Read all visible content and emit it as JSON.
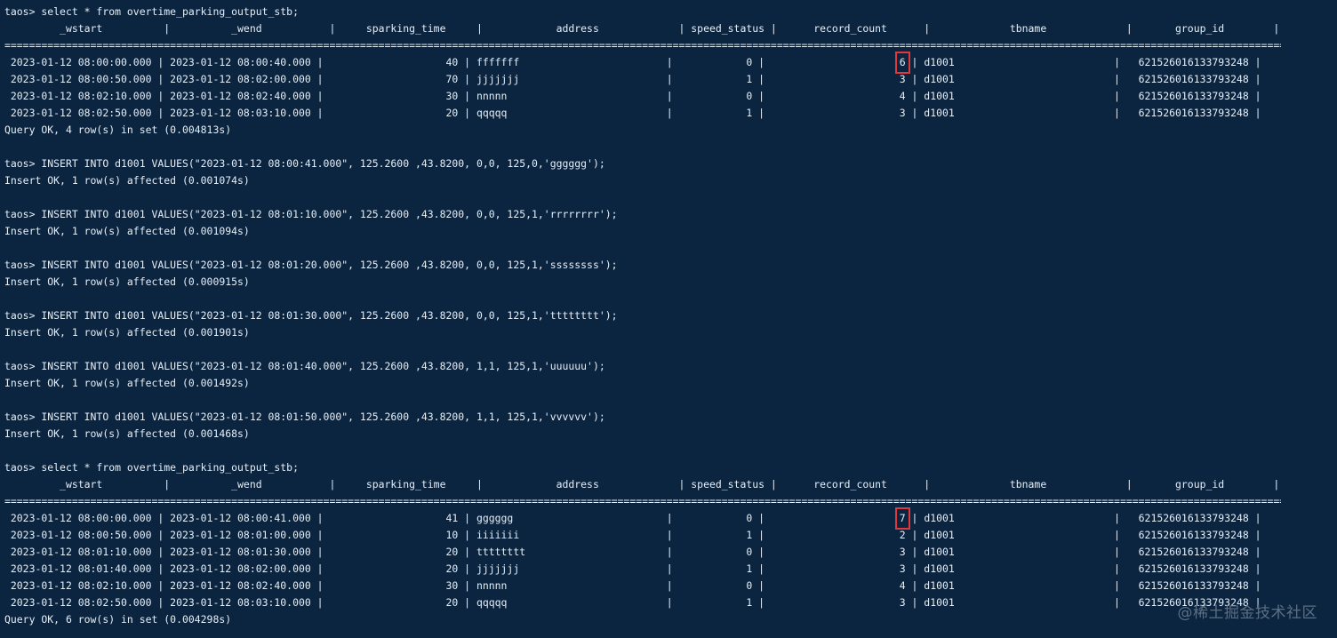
{
  "terminal": {
    "lines": [
      "taos> select * from overtime_parking_output_stb;",
      "         _wstart          |          _wend           |     sparking_time     |            address             | speed_status |      record_count      |             tbname             |       group_id        |",
      "=========================================================================================================================================================================================================================",
      " 2023-01-12 08:00:00.000 | 2023-01-12 08:00:40.000 |                    40 | fffffff                        |            0 |                      6 | d1001                          |   6215260161337932​48 |",
      " 2023-01-12 08:00:50.000 | 2023-01-12 08:02:00.000 |                    70 | jjjjjjj                        |            1 |                      3 | d1001                          |   621526016133793248 |",
      " 2023-01-12 08:02:10.000 | 2023-01-12 08:02:40.000 |                    30 | nnnnn                          |            0 |                      4 | d1001                          |   621526016133793248 |",
      " 2023-01-12 08:02:50.000 | 2023-01-12 08:03:10.000 |                    20 | qqqqq                          |            1 |                      3 | d1001                          |   621526016133793248 |",
      "Query OK, 4 row(s) in set (0.004813s)",
      "",
      "taos> INSERT INTO d1001 VALUES(\"2023-01-12 08:00:41.000\", 125.2600 ,43.8200, 0,0, 125,0,'gggggg');",
      "Insert OK, 1 row(s) affected (0.001074s)",
      "",
      "taos> INSERT INTO d1001 VALUES(\"2023-01-12 08:01:10.000\", 125.2600 ,43.8200, 0,0, 125,1,'rrrrrrrr');",
      "Insert OK, 1 row(s) affected (0.001094s)",
      "",
      "taos> INSERT INTO d1001 VALUES(\"2023-01-12 08:01:20.000\", 125.2600 ,43.8200, 0,0, 125,1,'ssssssss');",
      "Insert OK, 1 row(s) affected (0.000915s)",
      "",
      "taos> INSERT INTO d1001 VALUES(\"2023-01-12 08:01:30.000\", 125.2600 ,43.8200, 0,0, 125,1,'tttttttt');",
      "Insert OK, 1 row(s) affected (0.001901s)",
      "",
      "taos> INSERT INTO d1001 VALUES(\"2023-01-12 08:01:40.000\", 125.2600 ,43.8200, 1,1, 125,1,'uuuuuu');",
      "Insert OK, 1 row(s) affected (0.001492s)",
      "",
      "taos> INSERT INTO d1001 VALUES(\"2023-01-12 08:01:50.000\", 125.2600 ,43.8200, 1,1, 125,1,'vvvvvv');",
      "Insert OK, 1 row(s) affected (0.001468s)",
      "",
      "taos> select * from overtime_parking_output_stb;",
      "         _wstart          |          _wend           |     sparking_time     |            address             | speed_status |      record_count      |             tbname             |       group_id        |",
      "=========================================================================================================================================================================================================================",
      " 2023-01-12 08:00:00.000 | 2023-01-12 08:00:41.000 |                    41 | gggggg                         |            0 |                      7 | d1001                          |   621526016133793248 |",
      " 2023-01-12 08:00:50.000 | 2023-01-12 08:01:00.000 |                    10 | iiiiiii                        |            1 |                      2 | d1001                          |   621526016133793248 |",
      " 2023-01-12 08:01:10.000 | 2023-01-12 08:01:30.000 |                    20 | tttttttt                       |            0 |                      3 | d1001                          |   621526016133793248 |",
      " 2023-01-12 08:01:40.000 | 2023-01-12 08:02:00.000 |                    20 | jjjjjjj                        |            1 |                      3 | d1001                          |   621526016133793248 |",
      " 2023-01-12 08:02:10.000 | 2023-01-12 08:02:40.000 |                    30 | nnnnn                          |            0 |                      4 | d1001                          |   621526016133793248 |",
      " 2023-01-12 08:02:50.000 | 2023-01-12 08:03:10.000 |                    20 | qqqqq                          |            1 |                      3 | d1001                          |   621526016133793248 |",
      "Query OK, 6 row(s) in set (0.004298s)"
    ],
    "highlights": [
      {
        "line": 3,
        "text": "6"
      },
      {
        "line": 30,
        "text": "7"
      }
    ]
  },
  "watermark": "@稀土掘金技术社区",
  "colors": {
    "background": "#0b2540",
    "text": "#e6eef6",
    "highlight_box": "#e0383b"
  }
}
